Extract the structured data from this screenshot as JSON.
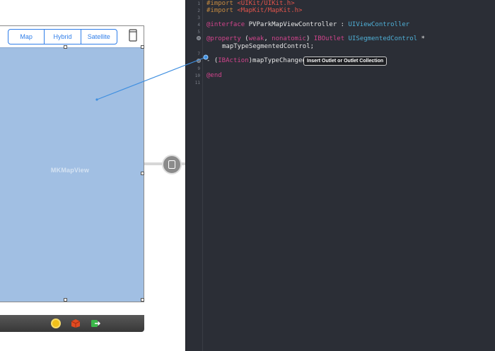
{
  "ib": {
    "segments": [
      "Map",
      "Hybrid",
      "Satellite"
    ],
    "map_view_label": "MKMapView"
  },
  "editor": {
    "line_numbers": [
      "1",
      "2",
      "3",
      "4",
      "5",
      "6",
      "",
      "7",
      "8",
      "9",
      "10",
      "11"
    ],
    "lines": {
      "l1_directive": "#import",
      "l1_path": "<UIKit/UIKit.h>",
      "l2_directive": "#import",
      "l2_path": "<MapKit/MapKit.h>",
      "l4_kw": "@interface",
      "l4_name": "PVParkMapViewController",
      "l4_colon": ":",
      "l4_super": "UIViewController",
      "l6_kw": "@property",
      "l6_attrs_open": "(",
      "l6_weak": "weak",
      "l6_comma": ",",
      "l6_nonatomic": "nonatomic",
      "l6_attrs_close": ")",
      "l6_outlet": "IBOutlet",
      "l6_type": "UISegmentedControl",
      "l6_star": "*",
      "l6_cont": "mapTypeSegmentedControl;",
      "l8_dash": "-",
      "l8_open": "(",
      "l8_action": "IBAction",
      "l8_close": ")",
      "l8_method": "mapTypeChanged",
      "l10_end": "@end"
    },
    "tooltip": "Insert Outlet or Outlet Collection"
  },
  "colors": {
    "ib_map_view": "#a1bfe3",
    "segment_tint": "#2f7ee9",
    "editor_bg": "#2b2e36",
    "keyword": "#d1448c",
    "type": "#4fb0d7",
    "string": "#e0544b"
  },
  "icons": [
    "view-controller-icon",
    "exit-icon",
    "first-responder-cube-icon",
    "segue-icon",
    "container-view-icon"
  ]
}
